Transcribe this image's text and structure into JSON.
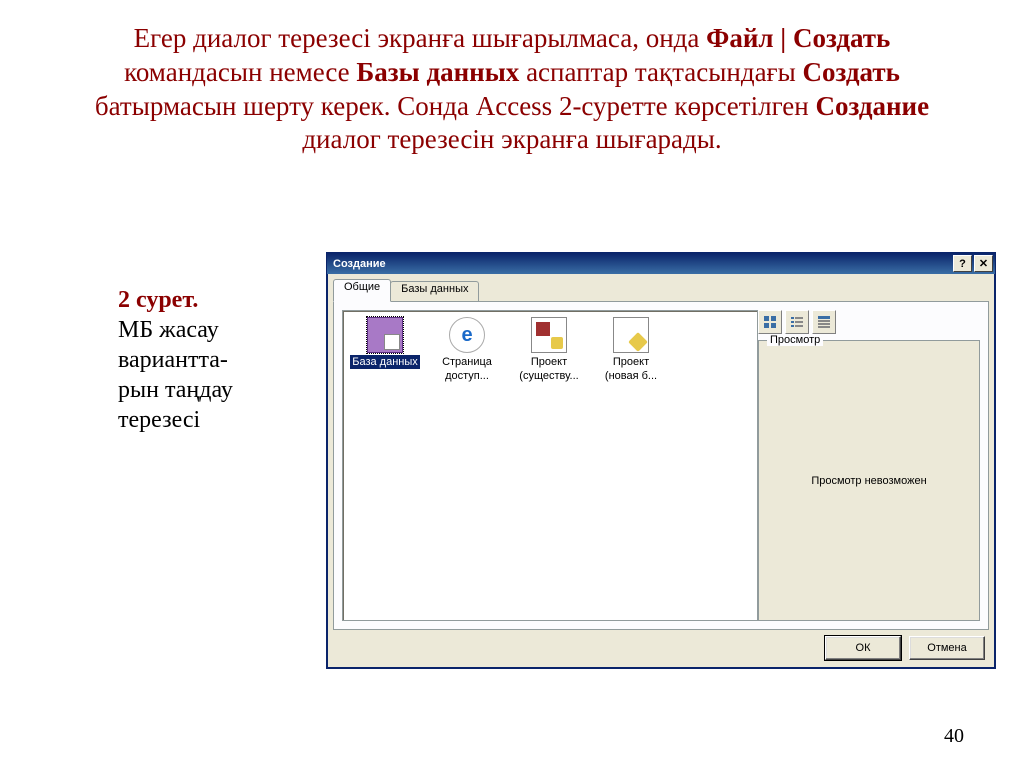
{
  "headline": {
    "t1": "Егер диалог терезесі экранға шығарылмаса, онда ",
    "b1": "Файл | Создать",
    "t2": " командасын немесе ",
    "b2": "Базы данных",
    "t3": " аспаптар тақтасындағы ",
    "b3": "Создать",
    "t4": " батырмасын шерту керек. Сонда Access 2-суретте көрсетілген  ",
    "b4": "Создание",
    "t5": " диалог терезесін экранға шығарады."
  },
  "caption": {
    "bold": "2 сурет.",
    "rest": "МБ жасау вариантта-\nрын таңдау терезесі"
  },
  "page_number": "40",
  "dialog": {
    "title": "Создание",
    "help_glyph": "?",
    "close_glyph": "✕",
    "tabs": {
      "active": "Общие",
      "other": "Базы данных"
    },
    "items": [
      {
        "label": "База данных",
        "glyph": "g-db",
        "selected": true
      },
      {
        "label": "Страница\nдоступ...",
        "glyph": "g-ie",
        "selected": false
      },
      {
        "label": "Проект\n(существу...",
        "glyph": "g-prj",
        "selected": false
      },
      {
        "label": "Проект\n(новая б...",
        "glyph": "g-prj2",
        "selected": false
      }
    ],
    "view_icons": [
      "large",
      "list",
      "details"
    ],
    "preview": {
      "group_label": "Просмотр",
      "message": "Просмотр невозможен"
    },
    "buttons": {
      "ok": "ОК",
      "cancel": "Отмена"
    }
  }
}
